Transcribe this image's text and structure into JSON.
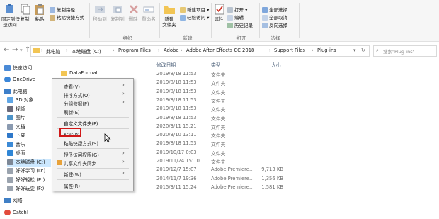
{
  "ribbon": {
    "clipboard": {
      "pin_label": "固定到快\n速访问",
      "copy_label": "复制",
      "paste_label": "粘贴",
      "copy_path": "复制路径",
      "paste_shortcut": "粘贴快捷方式"
    },
    "organize": {
      "move_to": "移动到",
      "copy_to": "复制到",
      "delete": "删除",
      "rename": "重命名",
      "group": "组织"
    },
    "new": {
      "new_folder": "新建\n文件夹",
      "new_item": "新建项目",
      "easy_access": "轻松访问",
      "group": "新建"
    },
    "open": {
      "properties": "属性",
      "open": "打开",
      "edit": "编辑",
      "history": "历史记录",
      "group": "打开"
    },
    "select": {
      "select_all": "全部选择",
      "select_none": "全部取消",
      "invert": "反向选择",
      "group": "选择"
    }
  },
  "address": {
    "crumbs": [
      "此电脑",
      "本地磁盘 (C:)",
      "Program Files",
      "Adobe",
      "Adobe After Effects CC 2018",
      "Support Files",
      "Plug-ins"
    ],
    "separator": "›",
    "search_placeholder": "搜索\"Plug-ins\""
  },
  "nav": {
    "quick_access": "快速访问",
    "onedrive": "OneDrive",
    "this_pc": "此电脑",
    "items": [
      "3D 对象",
      "视频",
      "图片",
      "文档",
      "下载",
      "音乐",
      "桌面",
      "本地磁盘 (C:)",
      "好好学习 (D:)",
      "好好轻松 (E:)",
      "好好玩耍 (F:)"
    ],
    "network": "网络",
    "catch": "Catch!"
  },
  "columns": {
    "date": "修改日期",
    "type": "类型",
    "size": "大小"
  },
  "files": {
    "first_name": "DataFormat",
    "rows": [
      {
        "date": "2019/8/18 11:53",
        "type": "文件夹",
        "size": ""
      },
      {
        "date": "2019/8/18 11:53",
        "type": "文件夹",
        "size": ""
      },
      {
        "date": "2019/8/18 11:53",
        "type": "文件夹",
        "size": ""
      },
      {
        "date": "2019/8/18 11:53",
        "type": "文件夹",
        "size": ""
      },
      {
        "date": "2019/8/18 11:53",
        "type": "文件夹",
        "size": ""
      },
      {
        "date": "2019/8/18 11:53",
        "type": "文件夹",
        "size": ""
      },
      {
        "date": "2020/3/11 15:21",
        "type": "文件夹",
        "size": ""
      },
      {
        "date": "2020/3/10 13:11",
        "type": "文件夹",
        "size": ""
      },
      {
        "date": "2019/8/18 11:53",
        "type": "文件夹",
        "size": ""
      },
      {
        "date": "2019/10/17 0:03",
        "type": "文件夹",
        "size": ""
      },
      {
        "date": "2019/11/24 15:10",
        "type": "文件夹",
        "size": ""
      },
      {
        "date": "2019/12/7 15:07",
        "type": "Adobe Premiere...",
        "size": "9,713 KB"
      },
      {
        "date": "2014/11/7 19:36",
        "type": "Adobe Premiere...",
        "size": "1,356 KB"
      },
      {
        "date": "2015/3/11 15:24",
        "type": "Adobe Premiere...",
        "size": "1,581 KB"
      }
    ]
  },
  "context_menu": {
    "view": "查看(V)",
    "sort": "排序方式(O)",
    "group": "分组依据(P)",
    "refresh": "刷新(E)",
    "customize": "自定义文件夹(F)...",
    "paste": "粘贴(P)",
    "paste_shortcut": "粘贴快捷方式(S)",
    "access": "授予访问权限(G)",
    "share_sync": "共享文件夹同步",
    "new": "新建(W)",
    "properties": "属性(R)"
  },
  "colors": {
    "highlight": "#d01818",
    "accent": "#1a73c7",
    "folder": "#f2c554"
  }
}
